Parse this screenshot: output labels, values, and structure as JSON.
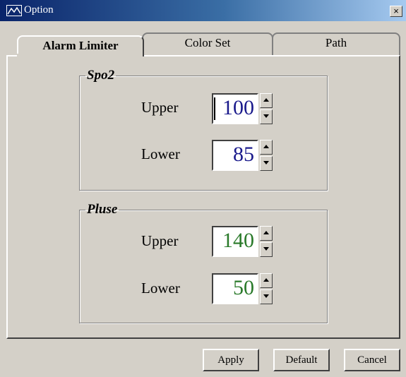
{
  "window": {
    "title": "Option",
    "close_glyph": "×",
    "icon": "chart-icon"
  },
  "tabs": [
    {
      "label": "Alarm Limiter",
      "active": true
    },
    {
      "label": "Color Set",
      "active": false
    },
    {
      "label": "Path",
      "active": false
    }
  ],
  "groups": {
    "spo2": {
      "title": "Spo2",
      "value_color": "#1a1a8c",
      "upper": {
        "label": "Upper",
        "value": "100"
      },
      "lower": {
        "label": "Lower",
        "value": "85"
      }
    },
    "pulse": {
      "title": "Pluse",
      "value_color": "#2a7a2a",
      "upper": {
        "label": "Upper",
        "value": "140"
      },
      "lower": {
        "label": "Lower",
        "value": "50"
      }
    }
  },
  "buttons": {
    "apply": "Apply",
    "default": "Default",
    "cancel": "Cancel"
  }
}
